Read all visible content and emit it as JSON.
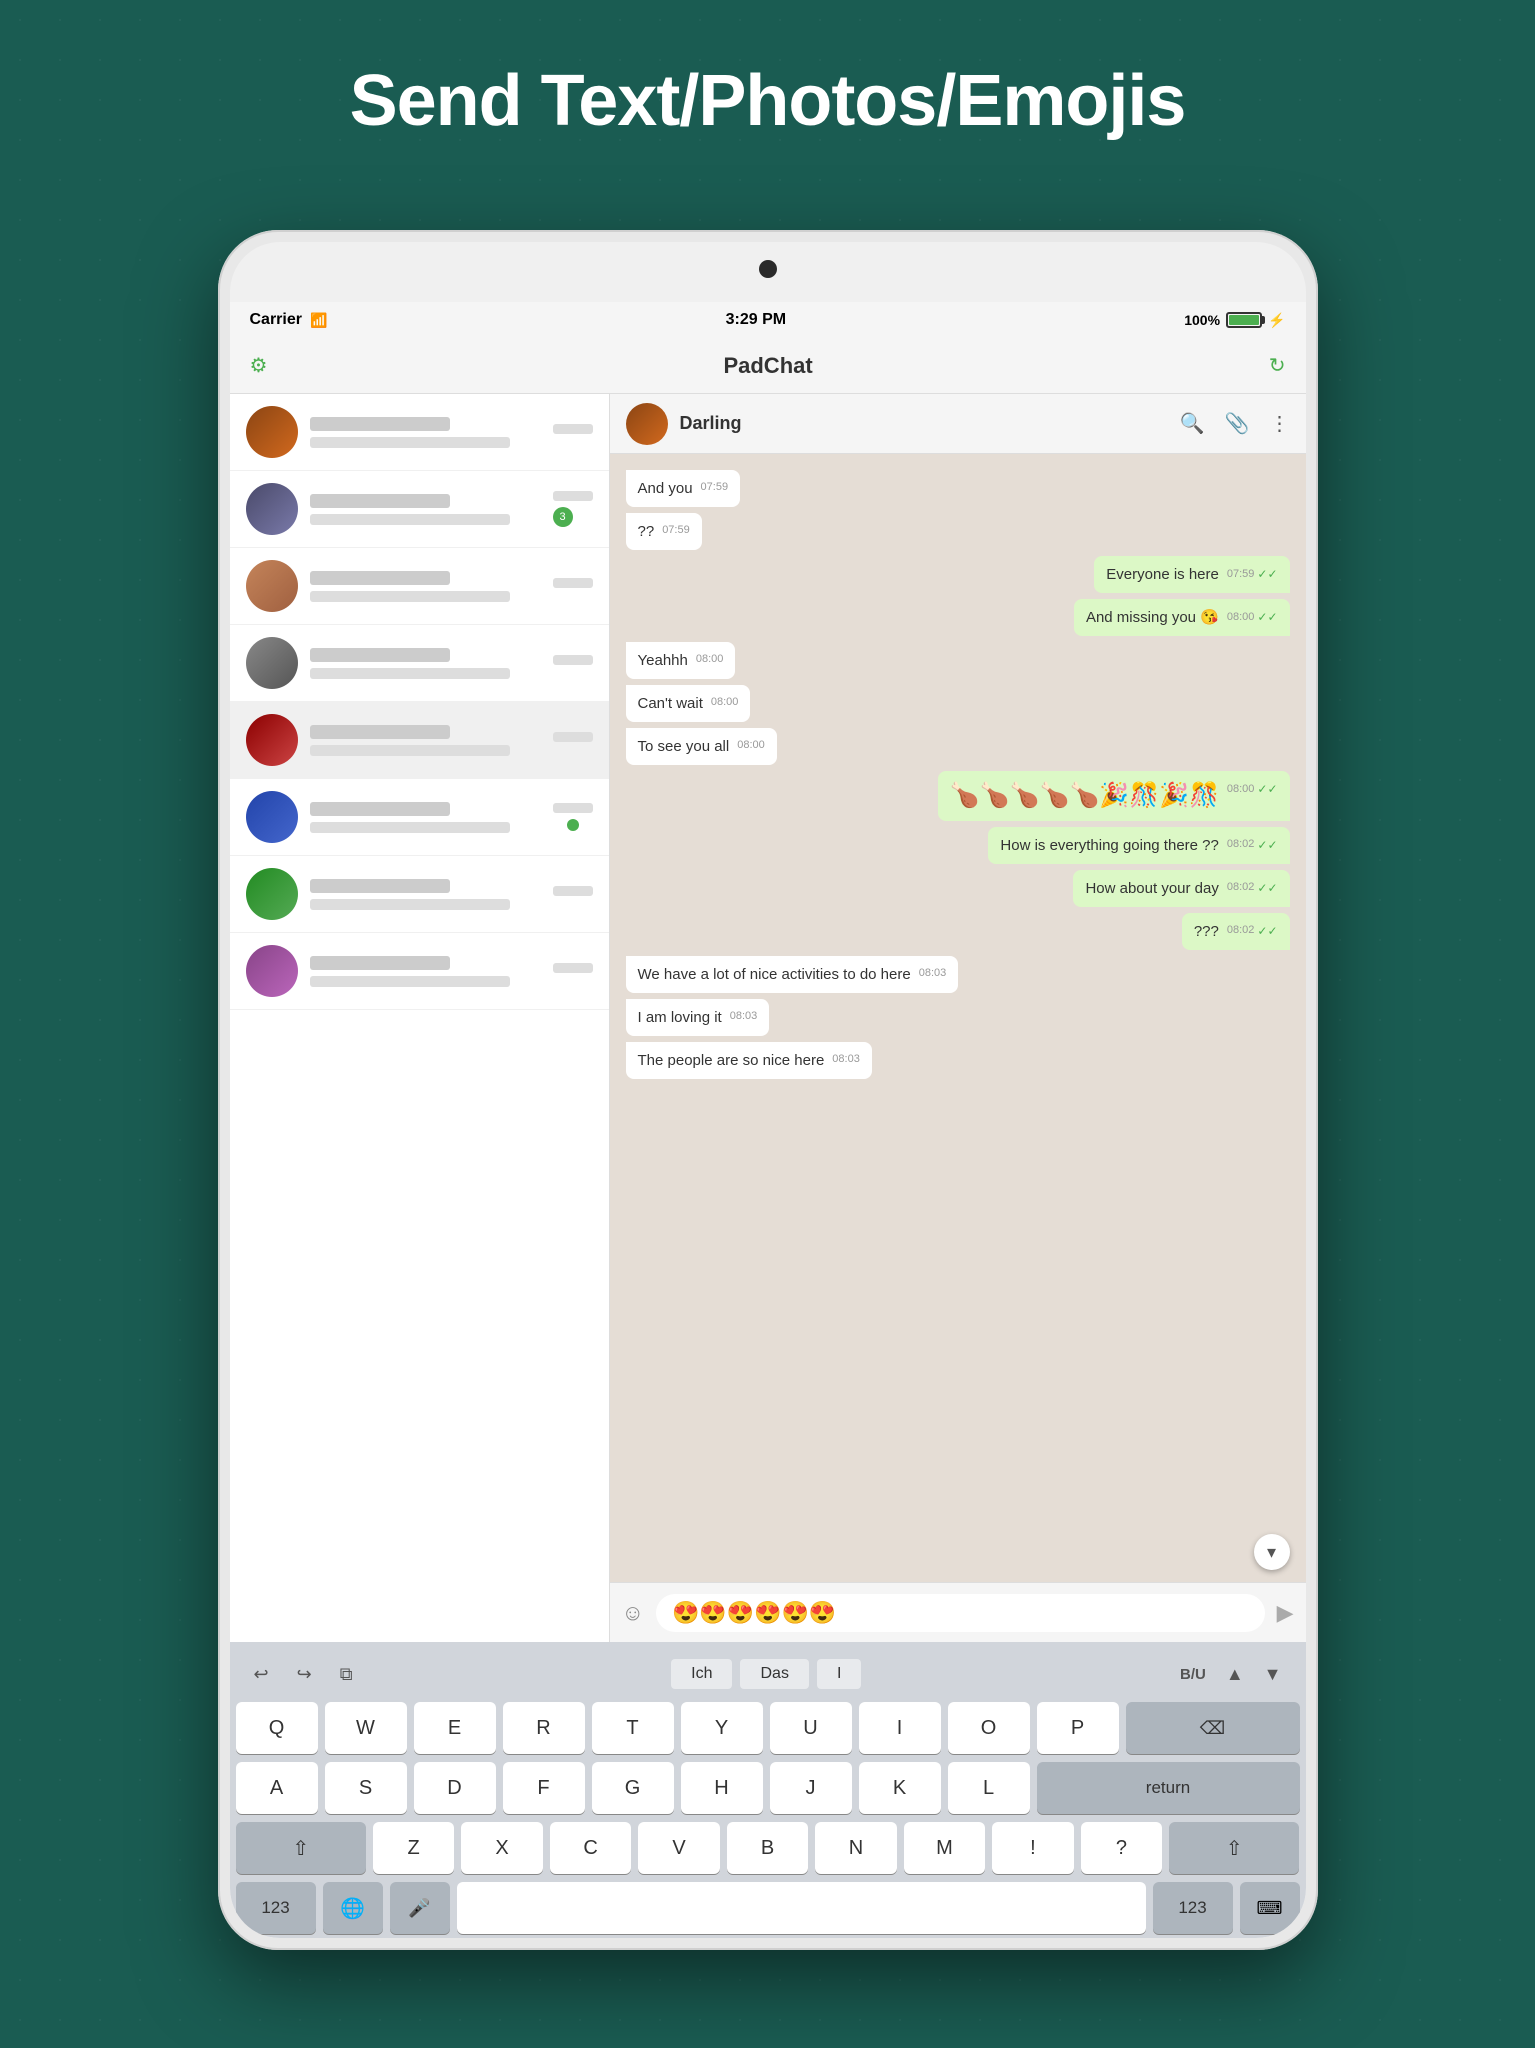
{
  "page": {
    "title": "Send Text/Photos/Emojis",
    "background_color": "#1a5c52"
  },
  "status_bar": {
    "carrier": "Carrier",
    "time": "3:29 PM",
    "battery": "100%"
  },
  "app_header": {
    "title": "PadChat"
  },
  "chat_header": {
    "contact_name": "Darling"
  },
  "sidebar": {
    "items": [
      {
        "id": 1,
        "avatar_class": "avatar-1"
      },
      {
        "id": 2,
        "avatar_class": "avatar-2"
      },
      {
        "id": 3,
        "avatar_class": "avatar-3"
      },
      {
        "id": 4,
        "avatar_class": "avatar-4"
      },
      {
        "id": 5,
        "avatar_class": "avatar-5"
      },
      {
        "id": 6,
        "avatar_class": "avatar-6"
      },
      {
        "id": 7,
        "avatar_class": "avatar-7"
      },
      {
        "id": 8,
        "avatar_class": "avatar-8"
      }
    ]
  },
  "messages": [
    {
      "id": 1,
      "type": "incoming",
      "text": "And you",
      "time": "07:59",
      "has_check": false
    },
    {
      "id": 2,
      "type": "incoming",
      "text": "??",
      "time": "07:59",
      "has_check": false
    },
    {
      "id": 3,
      "type": "outgoing",
      "text": "Everyone is here",
      "time": "07:59",
      "has_check": true
    },
    {
      "id": 4,
      "type": "outgoing",
      "text": "And missing you 😘",
      "time": "08:00",
      "has_check": true
    },
    {
      "id": 5,
      "type": "incoming",
      "text": "Yeahhh",
      "time": "08:00",
      "has_check": false
    },
    {
      "id": 6,
      "type": "incoming",
      "text": "Can't wait",
      "time": "08:00",
      "has_check": false
    },
    {
      "id": 7,
      "type": "incoming",
      "text": "To see you all",
      "time": "08:00",
      "has_check": false
    },
    {
      "id": 8,
      "type": "outgoing",
      "text": "🍗🍗🍗🍗🍗🎉🎊🎉🎊",
      "time": "08:00",
      "has_check": true,
      "is_emoji": true
    },
    {
      "id": 9,
      "type": "outgoing",
      "text": "How is everything going there ??",
      "time": "08:02",
      "has_check": true
    },
    {
      "id": 10,
      "type": "outgoing",
      "text": "How about your day",
      "time": "08:02",
      "has_check": true
    },
    {
      "id": 11,
      "type": "outgoing",
      "text": "???",
      "time": "08:02",
      "has_check": true
    },
    {
      "id": 12,
      "type": "incoming",
      "text": "We have a lot of nice activities to do here",
      "time": "08:03",
      "has_check": false
    },
    {
      "id": 13,
      "type": "incoming",
      "text": "I am loving it",
      "time": "08:03",
      "has_check": false
    },
    {
      "id": 14,
      "type": "incoming",
      "text": "The people are so nice here",
      "time": "08:03",
      "has_check": false
    }
  ],
  "input_area": {
    "emoji_icon": "☺",
    "value": "😍😍😍😍😍😍",
    "send_icon": "▶"
  },
  "keyboard": {
    "toolbar": {
      "undo_icon": "↩",
      "redo_icon": "↪",
      "copy_icon": "⧉",
      "suggestions": [
        "Ich",
        "Das",
        "I"
      ],
      "bold_label": "B/U",
      "up_icon": "▲",
      "down_icon": "▼"
    },
    "rows": [
      [
        "Q",
        "W",
        "E",
        "R",
        "T",
        "Y",
        "U",
        "I",
        "O",
        "P"
      ],
      [
        "A",
        "S",
        "D",
        "F",
        "G",
        "H",
        "J",
        "K",
        "L"
      ],
      [
        "Z",
        "X",
        "C",
        "V",
        "B",
        "N",
        "M",
        "!",
        "?"
      ]
    ],
    "bottom_row": {
      "number_label": "123",
      "emoji_label": "🌐",
      "mic_label": "🎤",
      "space_label": "",
      "number_label_right": "123",
      "keyboard_icon": "⌨"
    }
  }
}
